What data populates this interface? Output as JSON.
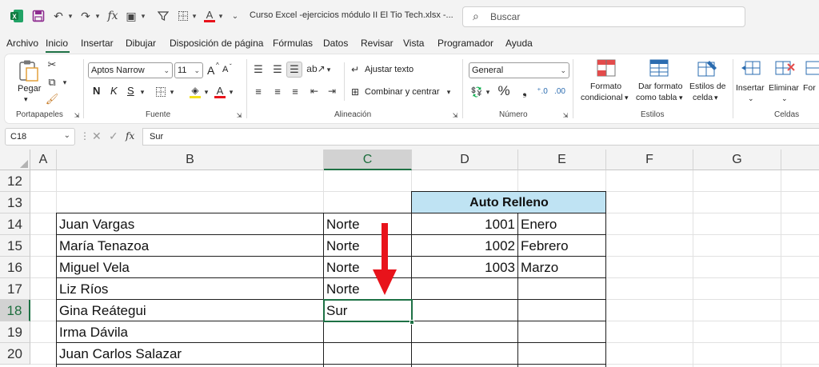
{
  "titlebar": {
    "doc_title": "Curso Excel -ejercicios módulo II El Tio Tech.xlsx  -...",
    "search_placeholder": "Buscar",
    "app_icon": "excel-icon"
  },
  "menu": [
    "Archivo",
    "Inicio",
    "Insertar",
    "Dibujar",
    "Disposición de página",
    "Fórmulas",
    "Datos",
    "Revisar",
    "Vista",
    "Programador",
    "Ayuda"
  ],
  "ribbon": {
    "portapapeles": {
      "label": "Portapapeles",
      "paste": "Pegar"
    },
    "fuente": {
      "label": "Fuente",
      "font_name": "Aptos Narrow",
      "font_size": "11",
      "bold": "N",
      "italic": "K",
      "underline": "S",
      "grow": "A",
      "shrink": "A"
    },
    "alineacion": {
      "label": "Alineación",
      "wrap": "Ajustar texto",
      "merge": "Combinar y centrar"
    },
    "numero": {
      "label": "Número",
      "format": "General"
    },
    "estilos": {
      "label": "Estilos",
      "cond_line1": "Formato",
      "cond_line2": "condicional",
      "table_line1": "Dar formato",
      "table_line2": "como tabla",
      "cell_line1": "Estilos de",
      "cell_line2": "celda"
    },
    "celdas": {
      "label": "Celdas",
      "insert": "Insertar",
      "delete": "Eliminar",
      "format": "For"
    }
  },
  "formula_bar": {
    "name_box": "C18",
    "fx": "fx",
    "value": "Sur"
  },
  "sheet": {
    "columns": [
      "A",
      "B",
      "C",
      "D",
      "E",
      "F",
      "G"
    ],
    "rows": [
      "12",
      "13",
      "14",
      "15",
      "16",
      "17",
      "18",
      "19",
      "20"
    ],
    "header_auto": "Auto Relleno",
    "header_fill": "#bfe3f3",
    "selected_cell": "C18",
    "arrow_color": "#e8131b",
    "names": [
      "Juan Vargas",
      "María Tenazoa",
      "Miguel Vela",
      "Liz Ríos",
      "Gina Reátegui",
      "Irma Dávila",
      "Juan Carlos Salazar"
    ],
    "region": [
      "Norte",
      "Norte",
      "Norte",
      "Norte",
      "Sur",
      "",
      ""
    ],
    "d_values": [
      "1001",
      "1002",
      "1003"
    ],
    "e_values": [
      "Enero",
      "Febrero",
      "Marzo"
    ]
  }
}
